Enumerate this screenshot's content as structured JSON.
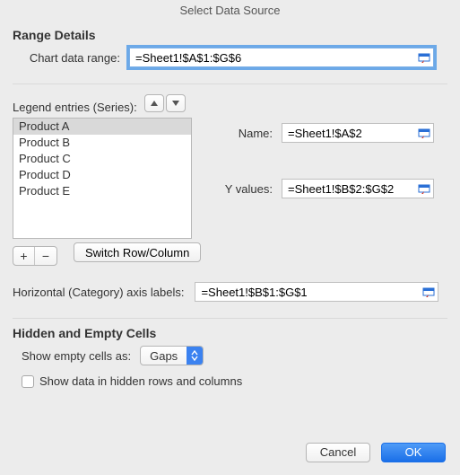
{
  "window": {
    "title": "Select Data Source"
  },
  "range": {
    "section_title": "Range Details",
    "label": "Chart data range:",
    "value": "=Sheet1!$A$1:$G$6"
  },
  "legend": {
    "label": "Legend entries (Series):",
    "items": [
      "Product A",
      "Product B",
      "Product C",
      "Product D",
      "Product E"
    ],
    "selected_index": 0,
    "switch_label": "Switch Row/Column"
  },
  "series": {
    "name_label": "Name:",
    "name_value": "=Sheet1!$A$2",
    "y_label": "Y values:",
    "y_value": "=Sheet1!$B$2:$G$2"
  },
  "category": {
    "label": "Horizontal (Category) axis labels:",
    "value": "=Sheet1!$B$1:$G$1"
  },
  "hidden": {
    "section_title": "Hidden and Empty Cells",
    "show_empty_label": "Show empty cells as:",
    "show_empty_value": "Gaps",
    "show_hidden_label": "Show data in hidden rows and columns",
    "show_hidden_checked": false
  },
  "footer": {
    "cancel": "Cancel",
    "ok": "OK"
  }
}
